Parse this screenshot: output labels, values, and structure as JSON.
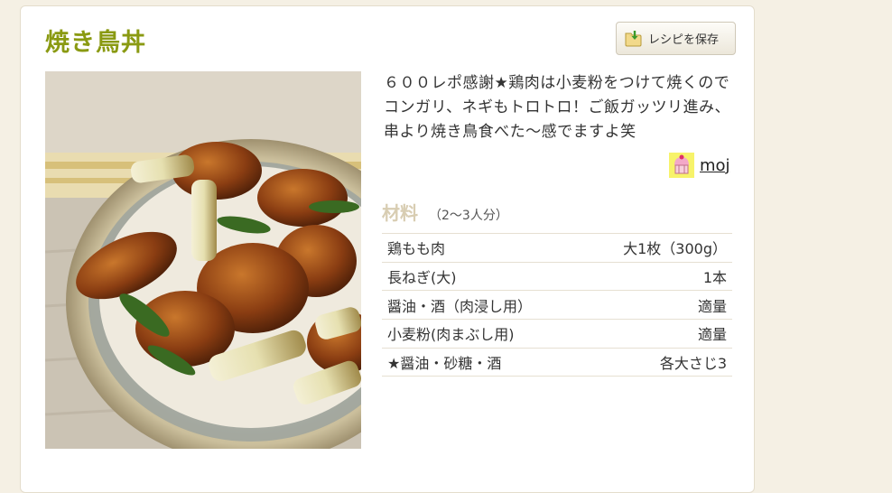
{
  "recipe": {
    "title": "焼き鳥丼",
    "save_button_label": "レシピを保存",
    "description": "６００レポ感謝★鶏肉は小麦粉をつけて焼くのでコンガリ、ネギもトロトロ！ご飯ガッツリ進み、串より焼き鳥食べた～感でますよ笑",
    "author": "moj",
    "ingredients_heading": "材料",
    "servings": "（2～3人分）",
    "ingredients": [
      {
        "name": "鶏もも肉",
        "qty": "大1枚（300g）"
      },
      {
        "name": "長ねぎ(大)",
        "qty": "1本"
      },
      {
        "name": "醤油・酒（肉浸し用）",
        "qty": "適量"
      },
      {
        "name": "小麦粉(肉まぶし用)",
        "qty": "適量"
      },
      {
        "name": "★醤油・砂糖・酒",
        "qty": "各大さじ3"
      }
    ]
  },
  "icons": {
    "save": "folder-download-icon",
    "author_avatar": "muffin-avatar-icon"
  },
  "colors": {
    "title": "#8a9a12",
    "ingredients_heading": "#d8cdb2",
    "page_bg": "#f5f0e4"
  }
}
